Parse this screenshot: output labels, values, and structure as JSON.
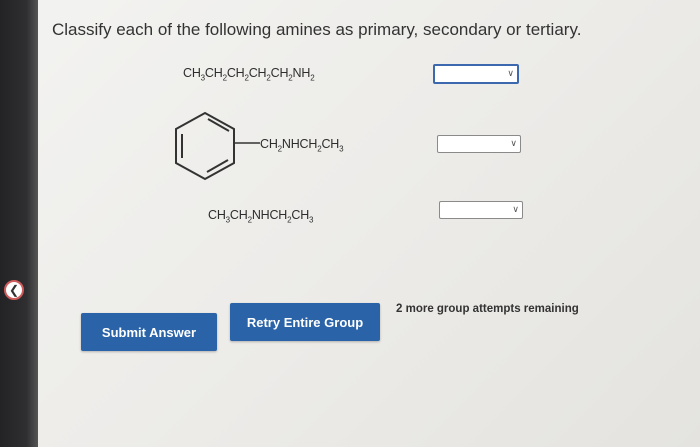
{
  "question": "Classify each of the following amines as primary, secondary or tertiary.",
  "amines": [
    {
      "formula_html": "CH<sub>3</sub>CH<sub>2</sub>CH<sub>2</sub>CH<sub>2</sub>CH<sub>2</sub>NH<sub>2</sub>",
      "selected": ""
    },
    {
      "substituent_html": "CH<sub>2</sub>NHCH<sub>2</sub>CH<sub>3</sub>",
      "ring": "benzene",
      "selected": ""
    },
    {
      "formula_html": "CH<sub>3</sub>CH<sub>2</sub>NHCH<sub>2</sub>CH<sub>3</sub>",
      "selected": ""
    }
  ],
  "buttons": {
    "submit": "Submit Answer",
    "retry": "Retry Entire Group"
  },
  "attempts_text": "2 more group attempts remaining",
  "icons": {
    "back": "back-arrow-icon",
    "dropdown": "chevron-down-icon"
  },
  "colors": {
    "button": "#2a63a8",
    "focus_border": "#3c68b0",
    "sidebar": "#2a2a2c"
  }
}
